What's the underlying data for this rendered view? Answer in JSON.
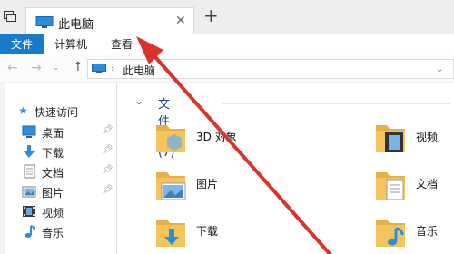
{
  "window": {
    "tab_title": "此电脑",
    "new_tab_symbol": "+",
    "close_symbol": "✕"
  },
  "ribbon": {
    "tabs": [
      {
        "label": "文件",
        "active": true
      },
      {
        "label": "计算机",
        "active": false
      },
      {
        "label": "查看",
        "active": false
      }
    ]
  },
  "address": {
    "back_symbol": "←",
    "forward_symbol": "→",
    "history_symbol": "⌄",
    "up_symbol": "↑",
    "separator": "›",
    "path": "此电脑",
    "dropdown_symbol": "⌄"
  },
  "nav": {
    "quick_access": "快速访问",
    "items": [
      {
        "label": "桌面",
        "icon": "desktop-icon",
        "pinned": true
      },
      {
        "label": "下载",
        "icon": "downloads-icon",
        "pinned": true
      },
      {
        "label": "文档",
        "icon": "documents-icon",
        "pinned": true
      },
      {
        "label": "图片",
        "icon": "pictures-icon",
        "pinned": true
      },
      {
        "label": "视频",
        "icon": "videos-icon",
        "pinned": false
      },
      {
        "label": "音乐",
        "icon": "music-icon",
        "pinned": false
      }
    ]
  },
  "content": {
    "group_title": "文件夹 (7)",
    "folders": [
      {
        "label": "3D 对象",
        "icon": "3d-objects-folder-icon"
      },
      {
        "label": "视频",
        "icon": "videos-folder-icon"
      },
      {
        "label": "图片",
        "icon": "pictures-folder-icon"
      },
      {
        "label": "文档",
        "icon": "documents-folder-icon"
      },
      {
        "label": "下载",
        "icon": "downloads-folder-icon"
      },
      {
        "label": "音乐",
        "icon": "music-folder-icon"
      }
    ]
  },
  "colors": {
    "accent": "#1979ca",
    "annotation_arrow": "#d9342b",
    "folder_body": "#f3c55a",
    "folder_back": "#e6b043"
  }
}
